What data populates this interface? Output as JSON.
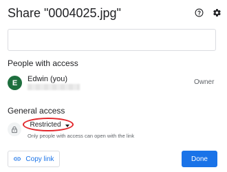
{
  "dialog": {
    "title": "Share \"0004025.jpg\"",
    "help_icon": "help-circle-icon",
    "settings_icon": "gear-icon"
  },
  "add_people": {
    "value": "",
    "placeholder": ""
  },
  "people_with_access": {
    "heading": "People with access",
    "people": [
      {
        "initial": "E",
        "name": "Edwin (you)",
        "role": "Owner",
        "avatar_color": "#1e6f3e"
      }
    ]
  },
  "general_access": {
    "heading": "General access",
    "icon": "lock-icon",
    "selected": "Restricted",
    "description": "Only people with access can open with the link",
    "highlight_color": "#e2262b"
  },
  "footer": {
    "copy_link_label": "Copy link",
    "copy_link_icon": "link-icon",
    "done_label": "Done",
    "accent_color": "#1a73e8"
  }
}
